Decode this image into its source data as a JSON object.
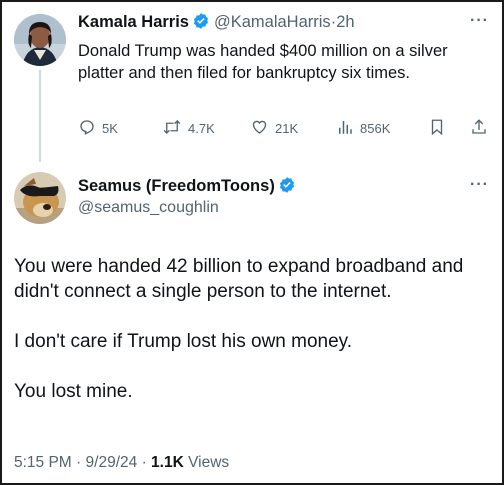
{
  "tweet1": {
    "author": "Kamala Harris",
    "handle": "@KamalaHarris",
    "sep": "·",
    "time": "2h",
    "text": "Donald Trump was handed $400 million on a silver platter and then filed for bankruptcy six times.",
    "replies": "5K",
    "retweets": "4.7K",
    "likes": "21K",
    "views": "856K",
    "more": "···"
  },
  "tweet2": {
    "author": "Seamus (FreedomToons)",
    "handle": "@seamus_coughlin",
    "paragraphs": [
      "You were handed 42 billion to expand broadband and didn't connect a single person to the internet.",
      "I don't care if Trump lost his own money.",
      "You lost mine."
    ],
    "time": "5:15 PM",
    "dot1": "·",
    "date": "9/29/24",
    "dot2": "·",
    "views_count": "1.1K",
    "views_label": "Views",
    "more": "···"
  },
  "colors": {
    "verified": "#1d9bf0",
    "muted": "#536471",
    "text": "#0f1419",
    "thread_line": "#cfd9de"
  },
  "icons": [
    "reply-icon",
    "retweet-icon",
    "like-icon",
    "views-icon",
    "bookmark-icon",
    "share-icon",
    "verified-badge-icon",
    "more-icon"
  ]
}
